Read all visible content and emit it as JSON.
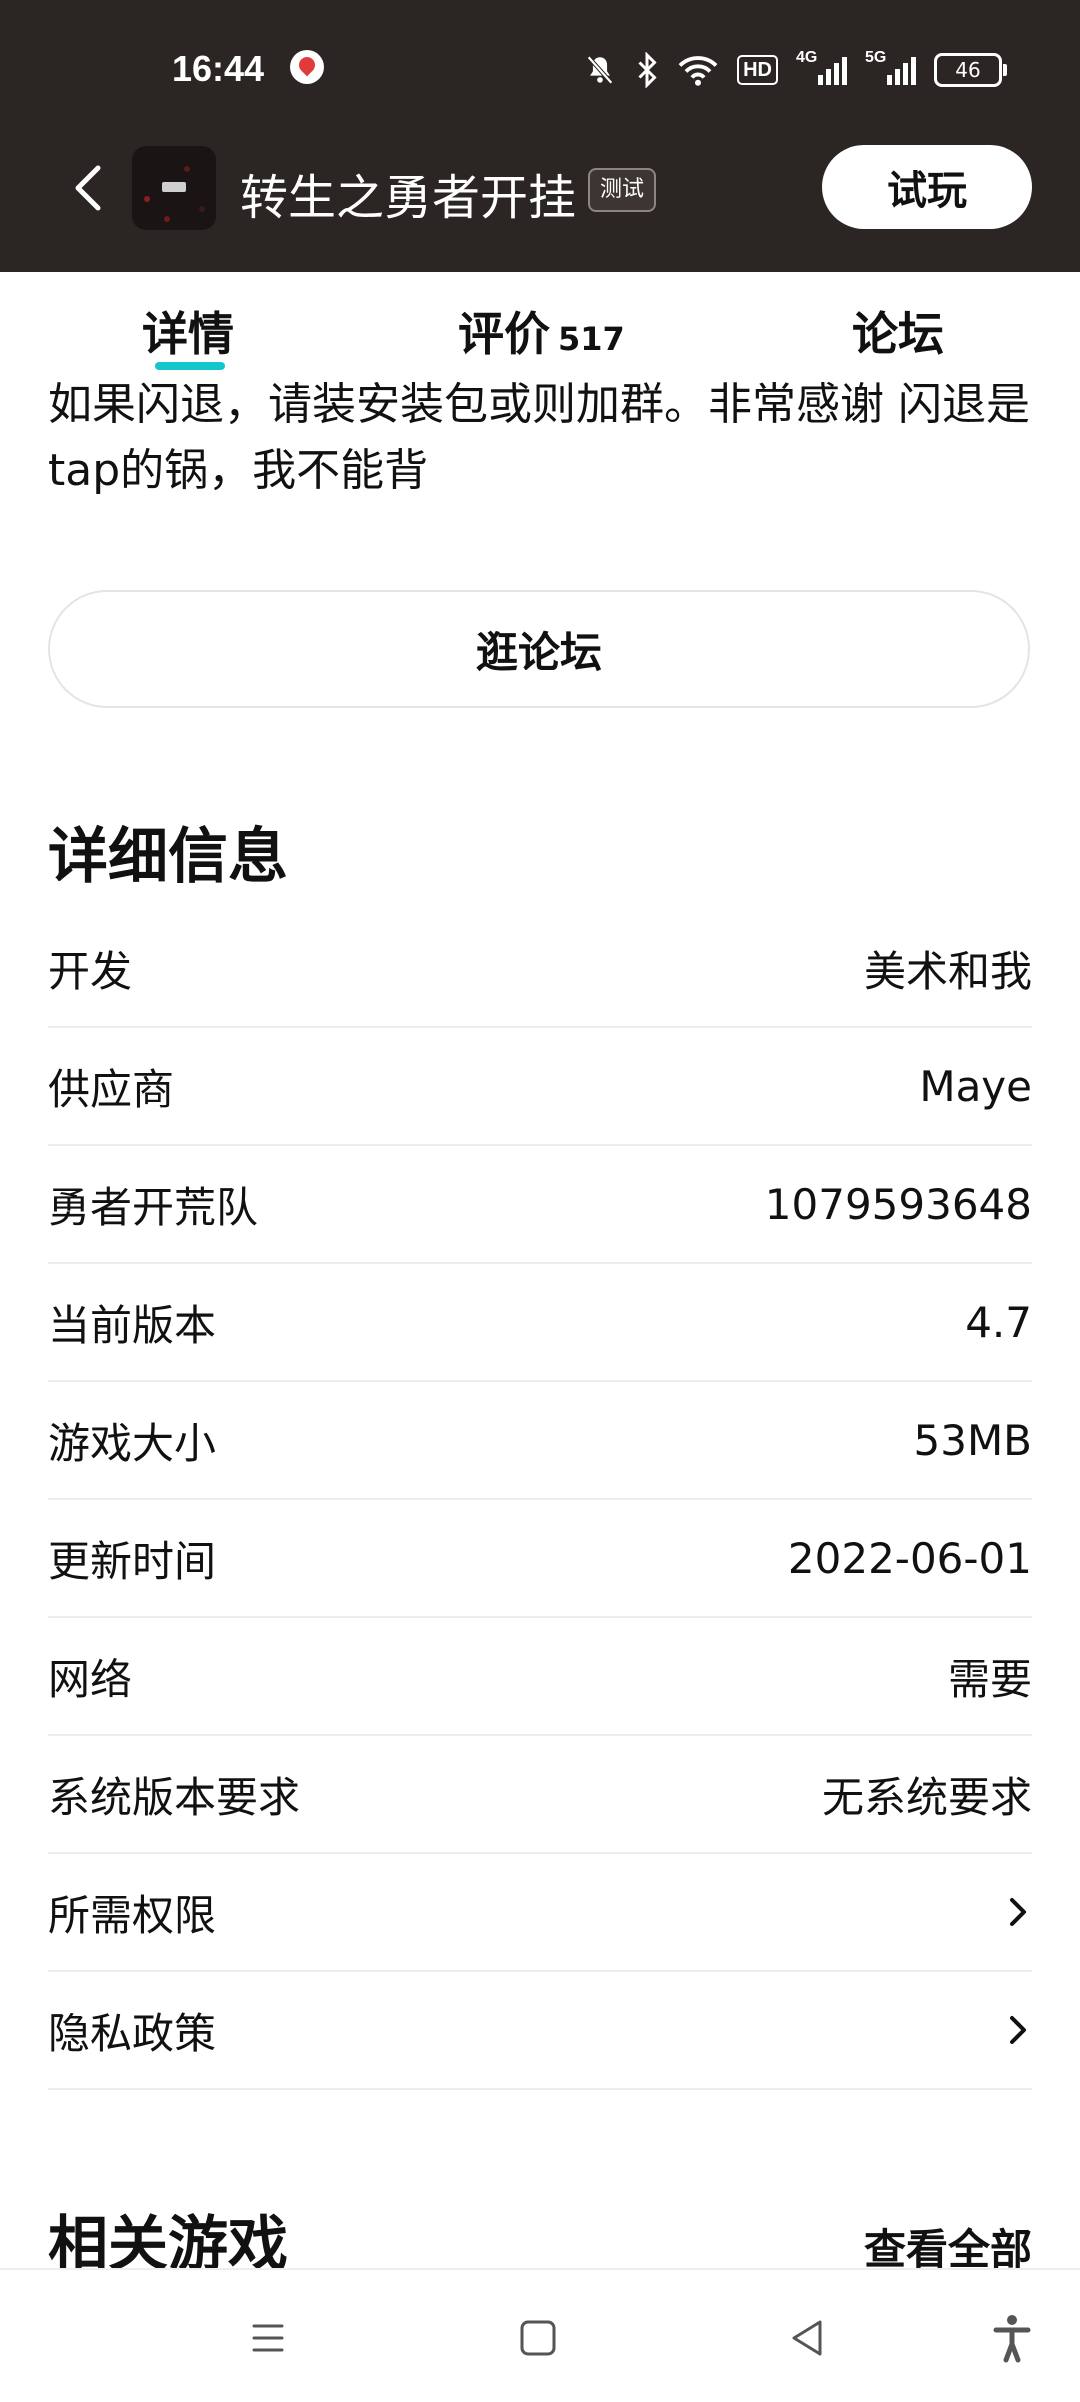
{
  "status_bar": {
    "time": "16:44",
    "hd_label": "HD",
    "net_4g": "4G",
    "net_5g": "5G",
    "battery": "46"
  },
  "header": {
    "app_title": "转生之勇者开挂",
    "badge": "测试",
    "trial_button": "试玩"
  },
  "tabs": [
    {
      "label": "详情"
    },
    {
      "label": "评价",
      "count": "517"
    },
    {
      "label": "论坛"
    }
  ],
  "description": "如果闪退，请装安装包或则加群。非常感谢 闪退是tap的锅，我不能背",
  "forum_button": "逛论坛",
  "details": {
    "title": "详细信息",
    "rows": [
      {
        "label": "开发",
        "value": "美术和我"
      },
      {
        "label": "供应商",
        "value": "Maye"
      },
      {
        "label": "勇者开荒队",
        "value": "1079593648"
      },
      {
        "label": "当前版本",
        "value": "4.7"
      },
      {
        "label": "游戏大小",
        "value": "53MB"
      },
      {
        "label": "更新时间",
        "value": "2022-06-01"
      },
      {
        "label": "网络",
        "value": "需要"
      },
      {
        "label": "系统版本要求",
        "value": "无系统要求"
      },
      {
        "label": "所需权限",
        "value": ""
      },
      {
        "label": "隐私政策",
        "value": ""
      }
    ]
  },
  "related": {
    "title": "相关游戏",
    "see_all": "查看全部"
  },
  "colors": {
    "header_bg": "#2b2523",
    "tab_indicator": "#15c5ce"
  }
}
